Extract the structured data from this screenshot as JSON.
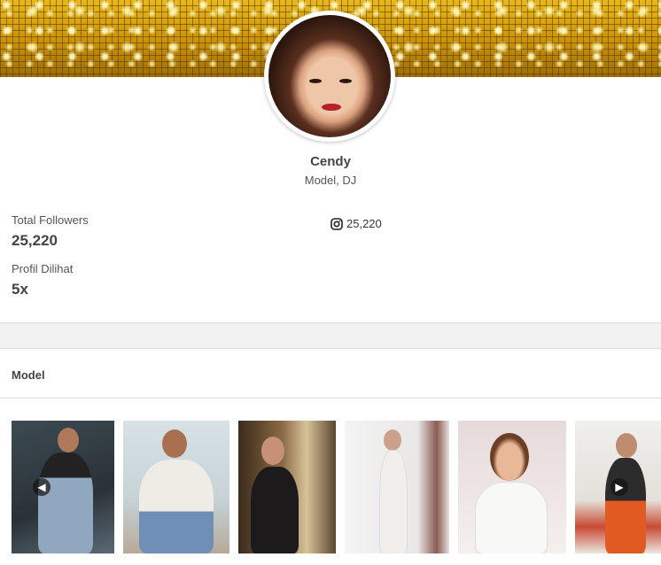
{
  "profile": {
    "name": "Cendy",
    "role": "Model, DJ"
  },
  "stats": {
    "followers_label": "Total Followers",
    "followers_value": "25,220",
    "views_label": "Profil Dilihat",
    "views_value": "5x"
  },
  "instagram": {
    "icon": "instagram-icon",
    "count": "25,220"
  },
  "section": {
    "title": "Model"
  },
  "gallery": {
    "prev_icon": "arrow-left-icon",
    "next_icon": "arrow-right-icon",
    "photo_count": 6
  },
  "colors": {
    "banner_gold": "#c89408",
    "text_dark": "#444444",
    "divider": "#dcdcdc",
    "band": "#f2f2f2"
  }
}
